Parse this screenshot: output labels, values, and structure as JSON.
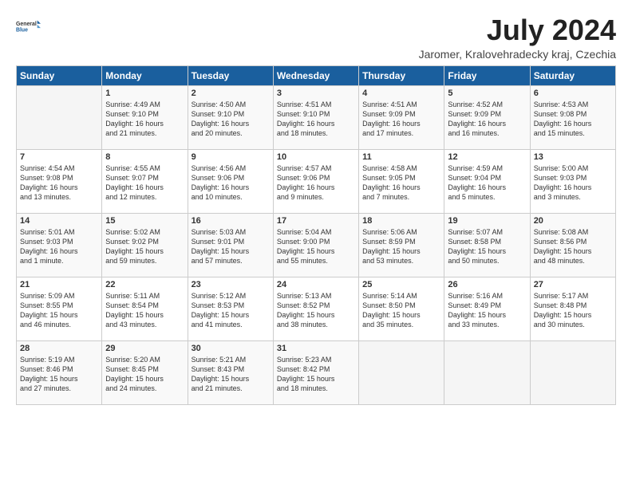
{
  "header": {
    "logo_general": "General",
    "logo_blue": "Blue",
    "title": "July 2024",
    "subtitle": "Jaromer, Kralovehradecky kraj, Czechia"
  },
  "weekdays": [
    "Sunday",
    "Monday",
    "Tuesday",
    "Wednesday",
    "Thursday",
    "Friday",
    "Saturday"
  ],
  "weeks": [
    [
      {
        "day": "",
        "text": ""
      },
      {
        "day": "1",
        "text": "Sunrise: 4:49 AM\nSunset: 9:10 PM\nDaylight: 16 hours\nand 21 minutes."
      },
      {
        "day": "2",
        "text": "Sunrise: 4:50 AM\nSunset: 9:10 PM\nDaylight: 16 hours\nand 20 minutes."
      },
      {
        "day": "3",
        "text": "Sunrise: 4:51 AM\nSunset: 9:10 PM\nDaylight: 16 hours\nand 18 minutes."
      },
      {
        "day": "4",
        "text": "Sunrise: 4:51 AM\nSunset: 9:09 PM\nDaylight: 16 hours\nand 17 minutes."
      },
      {
        "day": "5",
        "text": "Sunrise: 4:52 AM\nSunset: 9:09 PM\nDaylight: 16 hours\nand 16 minutes."
      },
      {
        "day": "6",
        "text": "Sunrise: 4:53 AM\nSunset: 9:08 PM\nDaylight: 16 hours\nand 15 minutes."
      }
    ],
    [
      {
        "day": "7",
        "text": "Sunrise: 4:54 AM\nSunset: 9:08 PM\nDaylight: 16 hours\nand 13 minutes."
      },
      {
        "day": "8",
        "text": "Sunrise: 4:55 AM\nSunset: 9:07 PM\nDaylight: 16 hours\nand 12 minutes."
      },
      {
        "day": "9",
        "text": "Sunrise: 4:56 AM\nSunset: 9:06 PM\nDaylight: 16 hours\nand 10 minutes."
      },
      {
        "day": "10",
        "text": "Sunrise: 4:57 AM\nSunset: 9:06 PM\nDaylight: 16 hours\nand 9 minutes."
      },
      {
        "day": "11",
        "text": "Sunrise: 4:58 AM\nSunset: 9:05 PM\nDaylight: 16 hours\nand 7 minutes."
      },
      {
        "day": "12",
        "text": "Sunrise: 4:59 AM\nSunset: 9:04 PM\nDaylight: 16 hours\nand 5 minutes."
      },
      {
        "day": "13",
        "text": "Sunrise: 5:00 AM\nSunset: 9:03 PM\nDaylight: 16 hours\nand 3 minutes."
      }
    ],
    [
      {
        "day": "14",
        "text": "Sunrise: 5:01 AM\nSunset: 9:03 PM\nDaylight: 16 hours\nand 1 minute."
      },
      {
        "day": "15",
        "text": "Sunrise: 5:02 AM\nSunset: 9:02 PM\nDaylight: 15 hours\nand 59 minutes."
      },
      {
        "day": "16",
        "text": "Sunrise: 5:03 AM\nSunset: 9:01 PM\nDaylight: 15 hours\nand 57 minutes."
      },
      {
        "day": "17",
        "text": "Sunrise: 5:04 AM\nSunset: 9:00 PM\nDaylight: 15 hours\nand 55 minutes."
      },
      {
        "day": "18",
        "text": "Sunrise: 5:06 AM\nSunset: 8:59 PM\nDaylight: 15 hours\nand 53 minutes."
      },
      {
        "day": "19",
        "text": "Sunrise: 5:07 AM\nSunset: 8:58 PM\nDaylight: 15 hours\nand 50 minutes."
      },
      {
        "day": "20",
        "text": "Sunrise: 5:08 AM\nSunset: 8:56 PM\nDaylight: 15 hours\nand 48 minutes."
      }
    ],
    [
      {
        "day": "21",
        "text": "Sunrise: 5:09 AM\nSunset: 8:55 PM\nDaylight: 15 hours\nand 46 minutes."
      },
      {
        "day": "22",
        "text": "Sunrise: 5:11 AM\nSunset: 8:54 PM\nDaylight: 15 hours\nand 43 minutes."
      },
      {
        "day": "23",
        "text": "Sunrise: 5:12 AM\nSunset: 8:53 PM\nDaylight: 15 hours\nand 41 minutes."
      },
      {
        "day": "24",
        "text": "Sunrise: 5:13 AM\nSunset: 8:52 PM\nDaylight: 15 hours\nand 38 minutes."
      },
      {
        "day": "25",
        "text": "Sunrise: 5:14 AM\nSunset: 8:50 PM\nDaylight: 15 hours\nand 35 minutes."
      },
      {
        "day": "26",
        "text": "Sunrise: 5:16 AM\nSunset: 8:49 PM\nDaylight: 15 hours\nand 33 minutes."
      },
      {
        "day": "27",
        "text": "Sunrise: 5:17 AM\nSunset: 8:48 PM\nDaylight: 15 hours\nand 30 minutes."
      }
    ],
    [
      {
        "day": "28",
        "text": "Sunrise: 5:19 AM\nSunset: 8:46 PM\nDaylight: 15 hours\nand 27 minutes."
      },
      {
        "day": "29",
        "text": "Sunrise: 5:20 AM\nSunset: 8:45 PM\nDaylight: 15 hours\nand 24 minutes."
      },
      {
        "day": "30",
        "text": "Sunrise: 5:21 AM\nSunset: 8:43 PM\nDaylight: 15 hours\nand 21 minutes."
      },
      {
        "day": "31",
        "text": "Sunrise: 5:23 AM\nSunset: 8:42 PM\nDaylight: 15 hours\nand 18 minutes."
      },
      {
        "day": "",
        "text": ""
      },
      {
        "day": "",
        "text": ""
      },
      {
        "day": "",
        "text": ""
      }
    ]
  ]
}
